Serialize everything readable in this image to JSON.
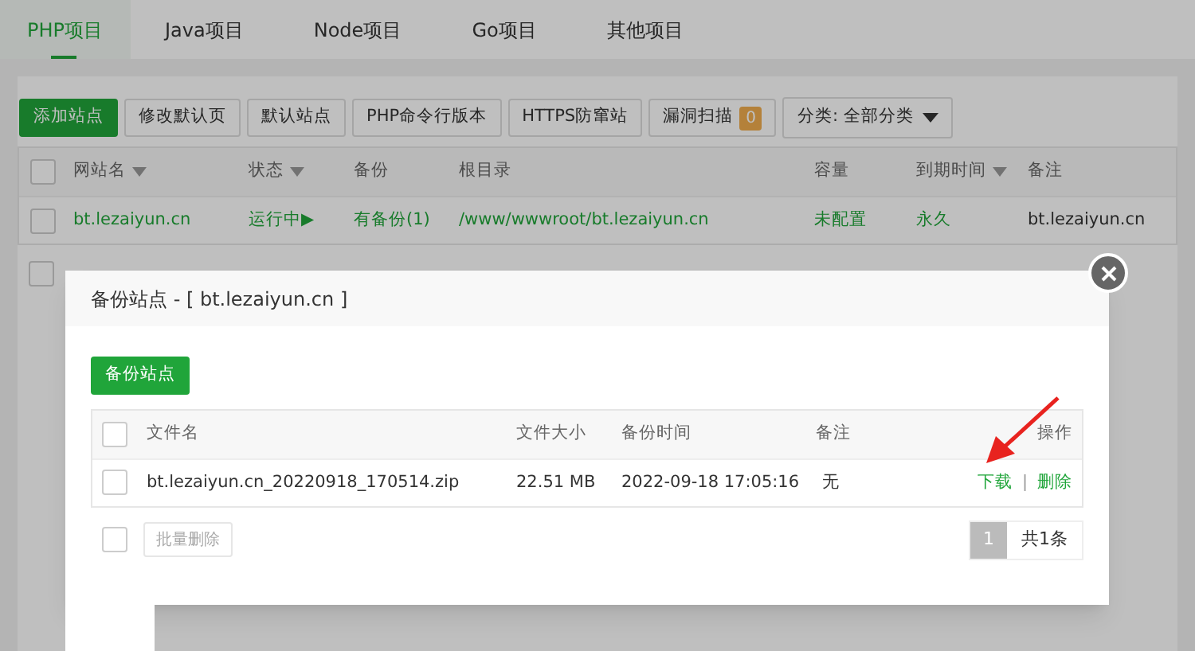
{
  "tabs": [
    {
      "label": "PHP项目",
      "selected": true
    },
    {
      "label": "Java项目",
      "selected": false
    },
    {
      "label": "Node项目",
      "selected": false
    },
    {
      "label": "Go项目",
      "selected": false
    },
    {
      "label": "其他项目",
      "selected": false
    }
  ],
  "toolbar": {
    "buttons": [
      {
        "label": "添加站点",
        "kind": "primary"
      },
      {
        "label": "修改默认页",
        "kind": "default"
      },
      {
        "label": "默认站点",
        "kind": "default"
      },
      {
        "label": "PHP命令行版本",
        "kind": "default"
      },
      {
        "label": "HTTPS防窜站",
        "kind": "default"
      },
      {
        "label": "漏洞扫描",
        "kind": "badge",
        "badge": "0"
      }
    ],
    "category": "分类: 全部分类"
  },
  "sites_table": {
    "columns": [
      {
        "label": "网站名",
        "sortable": true
      },
      {
        "label": "状态",
        "sortable": true
      },
      {
        "label": "备份",
        "sortable": false
      },
      {
        "label": "根目录",
        "sortable": false
      },
      {
        "label": "容量",
        "sortable": false
      },
      {
        "label": "到期时间",
        "sortable": true
      },
      {
        "label": "备注",
        "sortable": false
      }
    ],
    "header_checked": false,
    "rows": [
      {
        "checked": false,
        "cells": [
          "bt.lezaiyun.cn",
          "运行中▶",
          "有备份(1)",
          "/www/wwwroot/bt.lezaiyun.cn",
          "未配置",
          "永久",
          "bt.lezaiyun.cn"
        ]
      }
    ],
    "footer_checked": false
  },
  "dialog": {
    "title": "备份站点 - [ bt.lezaiyun.cn ]",
    "backup_button": "备份站点",
    "header_checked": false,
    "footer_checked": false,
    "columns": [
      "文件名",
      "文件大小",
      "备份时间",
      "备注",
      "操作"
    ],
    "rows": [
      {
        "checked": false,
        "file": "bt.lezaiyun.cn_20220918_170514.zip",
        "size": "22.51 MB",
        "time": "2022-09-18 17:05:16",
        "note": "无",
        "download": "下载",
        "separator": "|",
        "delete": "删除"
      }
    ],
    "batch_delete": "批量删除",
    "page": "1",
    "total": "共1条"
  }
}
